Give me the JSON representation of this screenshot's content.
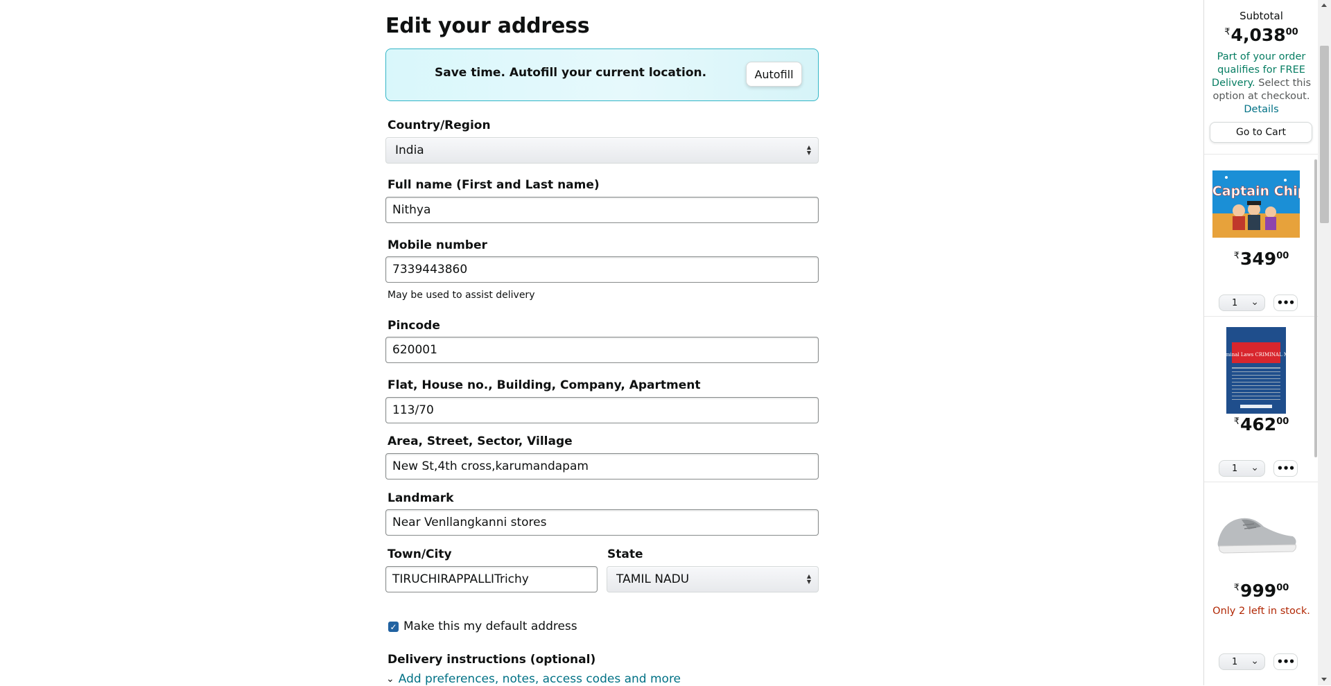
{
  "page": {
    "title": "Edit your address"
  },
  "autofill": {
    "text": "Save time. Autofill your current location.",
    "button": "Autofill"
  },
  "form": {
    "country": {
      "label": "Country/Region",
      "value": "India"
    },
    "full_name": {
      "label": "Full name (First and Last name)",
      "value": "Nithya"
    },
    "mobile": {
      "label": "Mobile number",
      "value": "7339443860",
      "hint": "May be used to assist delivery"
    },
    "pincode": {
      "label": "Pincode",
      "value": "620001"
    },
    "flat": {
      "label": "Flat, House no., Building, Company, Apartment",
      "value": "113/70"
    },
    "area": {
      "label": "Area, Street, Sector, Village",
      "value": "New St,4th cross,karumandapam"
    },
    "landmark": {
      "label": "Landmark",
      "value": "Near Venllangkanni stores"
    },
    "city": {
      "label": "Town/City",
      "value": "TIRUCHIRAPPALLITrichy"
    },
    "state": {
      "label": "State",
      "value": "TAMIL NADU"
    },
    "default_address": {
      "label": "Make this my default address",
      "checked": true
    },
    "delivery": {
      "label": "Delivery instructions (optional)",
      "link": "Add preferences, notes, access codes and more"
    }
  },
  "cart": {
    "subtotal_label": "Subtotal",
    "subtotal": {
      "currency": "₹",
      "whole": "4,038",
      "fraction": "00"
    },
    "free_delivery_text": "Part of your order qualifies for FREE Delivery.",
    "free_delivery_sub": "Select this option at checkout.",
    "details_link": "Details",
    "go_to_cart": "Go to Cart",
    "items": [
      {
        "name": "Captain Chip book",
        "currency": "₹",
        "whole": "349",
        "fraction": "00",
        "qty": "1",
        "cover_title": "Captain Chip"
      },
      {
        "name": "New Criminal Laws Criminal Manual",
        "currency": "₹",
        "whole": "462",
        "fraction": "00",
        "qty": "1",
        "cover_title": "New Criminal Laws CRIMINAL MANUAL"
      },
      {
        "name": "Grey sports shoe",
        "currency": "₹",
        "whole": "999",
        "fraction": "00",
        "qty": "1",
        "stock": "Only 2 left in stock."
      }
    ]
  },
  "colors": {
    "link": "#007185",
    "free": "#067d62",
    "stock": "#b12704",
    "checkbox": "#2162a1",
    "autofill_border": "#33b5c6"
  },
  "icons": [
    "select-caret-icon",
    "checkbox-check-icon",
    "chevron-down-icon",
    "more-icon"
  ]
}
